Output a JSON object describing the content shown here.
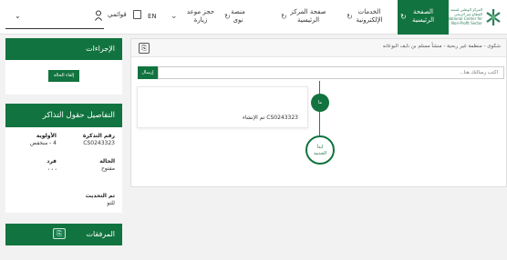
{
  "topbar": {
    "logo_text": [
      "المركز الوطني لتنمية",
      "القطاع غير الربحي",
      "National Center for",
      "Non-Profit Sector"
    ],
    "nav": {
      "home": [
        "الصفحة",
        "الرئيسية"
      ],
      "eservices": [
        "الخدمات",
        "الإلكترونية"
      ],
      "center_home": [
        "صفحة المركز",
        "الرئيسية"
      ],
      "nawa": [
        "منصة",
        "نوى"
      ],
      "booking": [
        "حجز موعد",
        "زيارة"
      ]
    },
    "language": "EN",
    "my_lists": "قوائمي"
  },
  "sidebar": {
    "actions_title": "الإجراءات",
    "cancel_case": "إلغاء الحالة",
    "ticket_details_title": "التفاصيل حقول التذاكر",
    "fields": {
      "ticket_number_label": "رقم التذكرة",
      "ticket_number_value": "CS0243323",
      "priority_label": "الأولوية",
      "priority_value": "4 - منخفض",
      "status_label": "الحالة",
      "status_value": "مفتوح",
      "individual_label": "فرد",
      "individual_value": "، ، ،",
      "updated_label": "تم التحديث",
      "updated_value": "للتو"
    },
    "attachments_title": "المرفقات"
  },
  "main": {
    "breadcrumb": "شكوى - منظمة غير ربحية - منشأ مسلم بن نايف البوعانه",
    "message_placeholder": "اكتب رسالتك هنا...",
    "send_label": "إرسال",
    "timeline": {
      "node_label": "ما",
      "card_text": "CS0243323 تم الإنشاء",
      "start_label": [
        "ابدأ",
        "الخدمة"
      ]
    }
  },
  "colors": {
    "brand_green": "#11733f"
  }
}
